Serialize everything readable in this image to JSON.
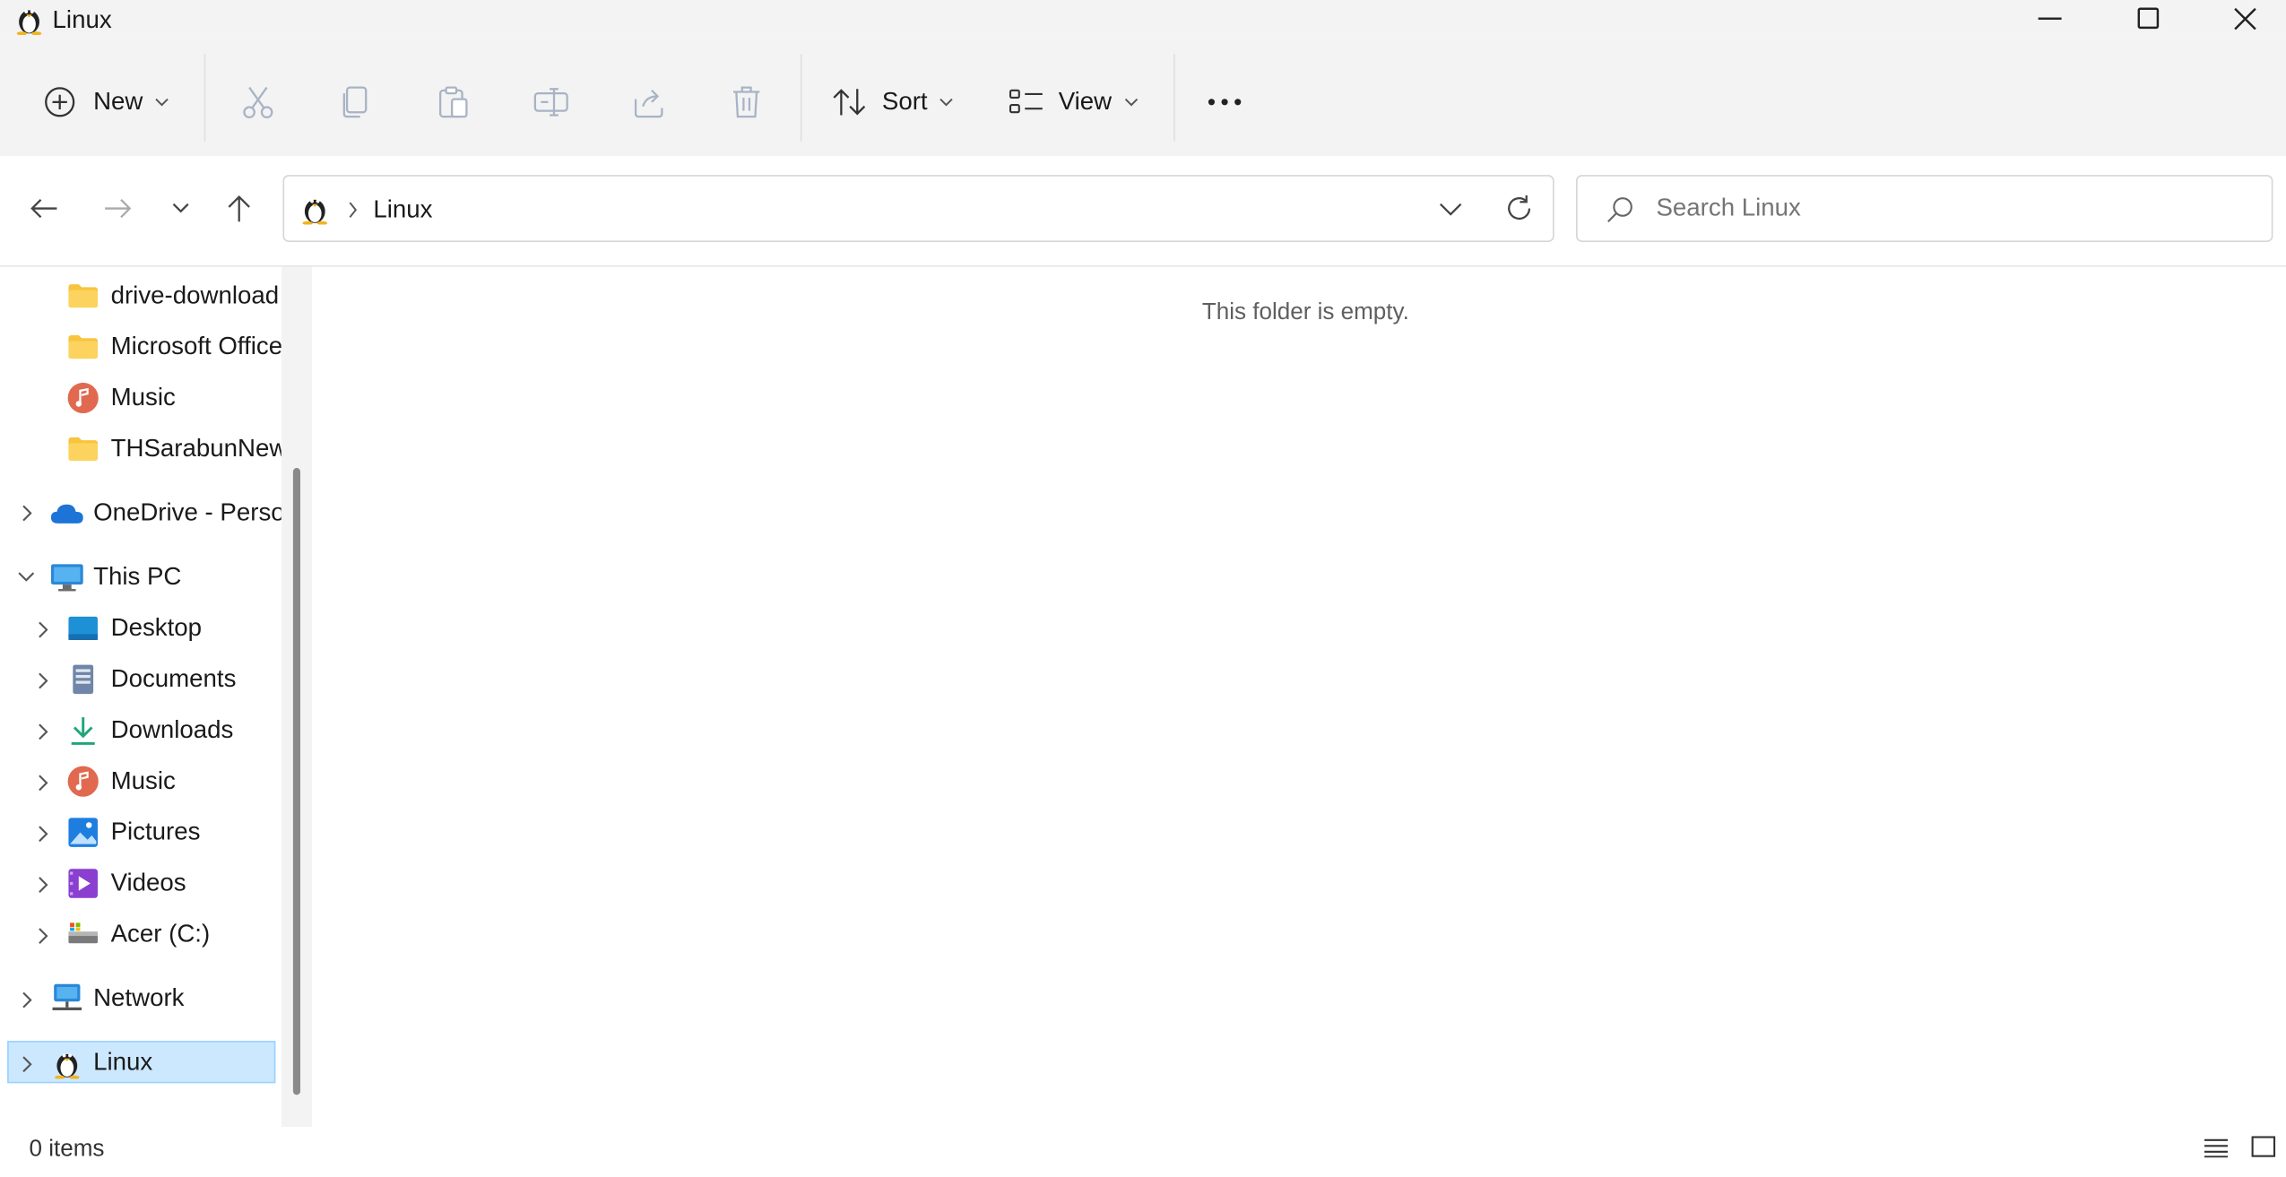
{
  "window": {
    "title": "Linux",
    "controls": [
      "minimize-icon",
      "maximize-icon",
      "close-icon"
    ]
  },
  "toolbar": {
    "new_label": "New",
    "sort_label": "Sort",
    "view_label": "View",
    "icons": [
      "cut-icon",
      "copy-icon",
      "paste-icon",
      "rename-icon",
      "share-icon",
      "delete-icon",
      "more-icon"
    ]
  },
  "address": {
    "crumb": "Linux",
    "search_placeholder": "Search Linux"
  },
  "sidebar": {
    "quick_items": [
      {
        "label": "drive-download",
        "icon": "folder-icon"
      },
      {
        "label": "Microsoft Office",
        "icon": "folder-icon"
      },
      {
        "label": "Music",
        "icon": "music-icon"
      },
      {
        "label": "THSarabunNew",
        "icon": "folder-icon"
      }
    ],
    "onedrive": "OneDrive - Personal",
    "this_pc": "This PC",
    "pc_items": [
      {
        "label": "Desktop",
        "icon": "desktop-icon"
      },
      {
        "label": "Documents",
        "icon": "documents-icon"
      },
      {
        "label": "Downloads",
        "icon": "downloads-icon"
      },
      {
        "label": "Music",
        "icon": "music-icon"
      },
      {
        "label": "Pictures",
        "icon": "pictures-icon"
      },
      {
        "label": "Videos",
        "icon": "videos-icon"
      },
      {
        "label": "Acer (C:)",
        "icon": "drive-icon"
      }
    ],
    "network": "Network",
    "linux": "Linux"
  },
  "content": {
    "empty_message": "This folder is empty."
  },
  "status": {
    "items_count": "0 items"
  },
  "colors": {
    "chrome_bg": "#f3f3f3",
    "selected_bg": "#cce8ff",
    "selected_border": "#99d1ff",
    "accent": "#0067c0",
    "folder": "#f8c43d"
  }
}
